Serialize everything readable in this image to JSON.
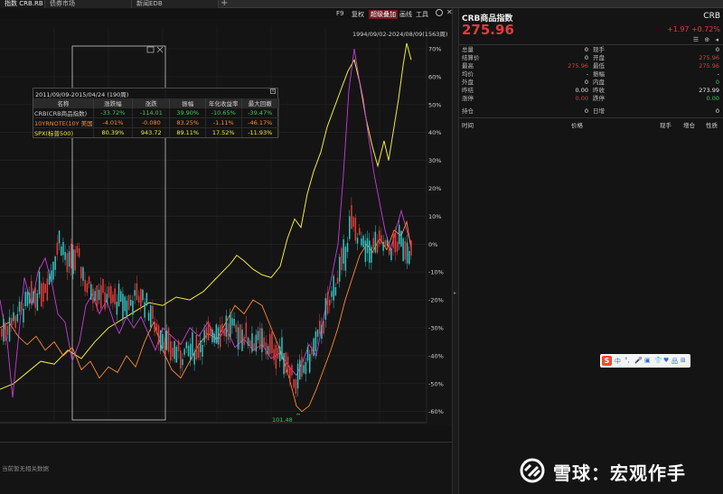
{
  "tabs": [
    {
      "label": "指数 CRB.RB",
      "active": true
    },
    {
      "label": "债券市场",
      "active": false
    },
    {
      "label": "新闻EDB",
      "active": false
    }
  ],
  "tab_add": "+",
  "toolbar": {
    "f9": "F9",
    "restore": "复权",
    "overlay": "超级叠加",
    "draw": "画线",
    "tools": "工具"
  },
  "chart_range": "1994/09/02-2024/08/09(1563周)",
  "chart_colors": {
    "candle_up": "#e23b3b",
    "candle_down": "#34c1c1",
    "treasury": "#ff8a2a",
    "spx": "#f2e83b",
    "magenta": "#c93bd8"
  },
  "stats": {
    "title": "2011/09/09-2015/04/24 (190周)",
    "headers": [
      "名称",
      "涨跌幅",
      "涨跌",
      "振幅",
      "年化收益率",
      "最大回撤"
    ],
    "rows": [
      {
        "name": "CRB(CRB商品指数)",
        "chg_pct": "-33.72%",
        "chg": "-114.01",
        "amp": "39.90%",
        "annual": "-10.65%",
        "drawdown": "-39.47%"
      },
      {
        "name": "10YRNOTE(10Y 美国",
        "chg_pct": "-4.01%",
        "chg": "-0.080",
        "amp": "83.25%",
        "annual": "-1.11%",
        "drawdown": "-46.17%"
      },
      {
        "name": "SPX(标普500)",
        "chg_pct": "80.39%",
        "chg": "943.72",
        "amp": "89.11%",
        "annual": "17.52%",
        "drawdown": "-11.93%"
      }
    ]
  },
  "bottom_panel": {
    "no_data": "当前暂无相关数据"
  },
  "quote": {
    "title": "CRB商品指数",
    "code": "CRB",
    "price": "275.96",
    "change": "+1.97",
    "change_pct": "+0.72%",
    "icons": "☰ ⊕ ◂",
    "left_rows": [
      {
        "label": "总量",
        "value": "0",
        "color": "white"
      },
      {
        "label": "结算价",
        "value": "0",
        "color": "white"
      },
      {
        "label": "最高",
        "value": "275.96",
        "color": "red"
      },
      {
        "label": "均价",
        "value": "-",
        "color": "white"
      },
      {
        "label": "外盘",
        "value": "0",
        "color": "white"
      },
      {
        "label": "昨结",
        "value": "0.00",
        "color": "white"
      },
      {
        "label": "涨停",
        "value": "0.00",
        "color": "red"
      }
    ],
    "right_rows": [
      {
        "label": "现手",
        "value": "0",
        "color": "white"
      },
      {
        "label": "开盘",
        "value": "275.96",
        "color": "red"
      },
      {
        "label": "最低",
        "value": "275.96",
        "color": "red"
      },
      {
        "label": "振幅",
        "value": "-",
        "color": "white"
      },
      {
        "label": "内盘",
        "value": "0",
        "color": "green"
      },
      {
        "label": "昨收",
        "value": "273.99",
        "color": "white"
      },
      {
        "label": "跌停",
        "value": "0.00",
        "color": "green"
      }
    ],
    "hold_label": "持仓",
    "hold_value": "0",
    "daily_label": "日增",
    "daily_value": "0",
    "trade_headers": [
      "时间",
      "价格",
      "现手",
      "增仓",
      "性质"
    ]
  },
  "y_axis": [
    "70%",
    "60%",
    "50%",
    "40%",
    "30%",
    "20%",
    "10%",
    "0%",
    "-10%",
    "-20%",
    "-30%",
    "-40%",
    "-50%",
    "-60%"
  ],
  "min_label": "101.48",
  "sogou": {
    "logo": "S",
    "items": [
      "中",
      "°,",
      "🎤",
      "▣",
      "👕",
      "♥",
      "品",
      "⊞"
    ]
  },
  "watermark": {
    "text": "雪球：宏观作手"
  }
}
